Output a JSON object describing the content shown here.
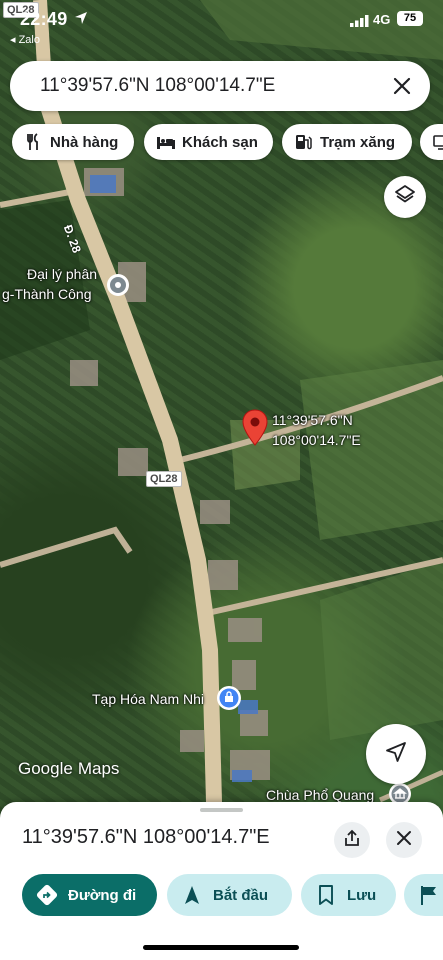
{
  "status_bar": {
    "time": "22:49",
    "back_app": "◂ Zalo",
    "network": "4G",
    "battery": "75"
  },
  "search": {
    "query": "11°39'57.6\"N 108°00'14.7\"E"
  },
  "chips": [
    {
      "label": "Nhà hàng",
      "icon": "fork-knife-icon"
    },
    {
      "label": "Khách sạn",
      "icon": "bed-icon"
    },
    {
      "label": "Trạm xăng",
      "icon": "gas-station-icon"
    }
  ],
  "map": {
    "pin_label_line1": "11°39'57.6\"N",
    "pin_label_line2": "108°00'14.7\"E",
    "poi_1_line1": "Đại lý phân",
    "poi_1_line2": "g-Thành Công",
    "poi_2": "Tạp Hóa Nam Nhi",
    "poi_3": "Chùa Phổ Quang",
    "road_label": "Đ. 28",
    "shield_top": "QL28",
    "shield_mid": "QL28",
    "logo_google": "Google",
    "logo_maps": "Maps"
  },
  "sheet": {
    "title": "11°39'57.6\"N 108°00'14.7\"E",
    "actions": [
      {
        "label": "Đường đi",
        "style": "primary"
      },
      {
        "label": "Bắt đầu",
        "style": "secondary"
      },
      {
        "label": "Lưu",
        "style": "secondary"
      }
    ]
  },
  "colors": {
    "accent": "#0b6e68",
    "secondary_button": "#c9ecef",
    "pin": "#ea4335"
  }
}
